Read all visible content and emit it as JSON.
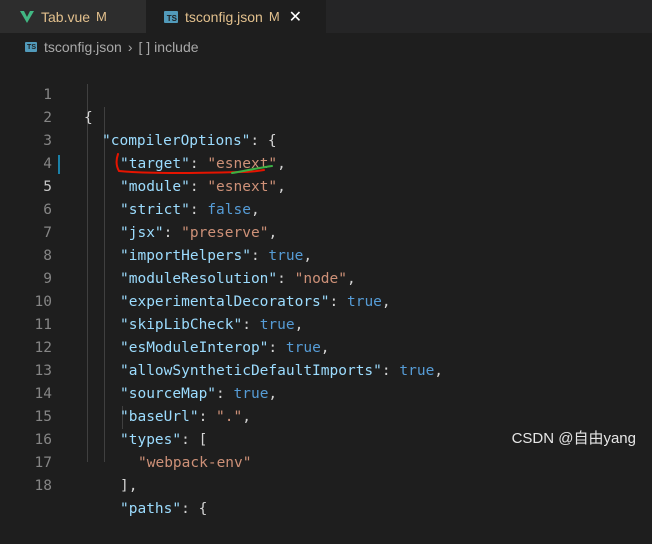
{
  "tabs": [
    {
      "label": "Tab.vue",
      "badge": "M",
      "icon": "vue-icon"
    },
    {
      "label": "tsconfig.json",
      "badge": "M",
      "icon": "ts-icon",
      "icon_text": "TS",
      "active": true
    }
  ],
  "tab_close_glyph": "✕",
  "breadcrumb": {
    "file": "tsconfig.json",
    "separator": "›",
    "symbol_icon": "[ ]",
    "symbol": "include"
  },
  "line_numbers": [
    "1",
    "2",
    "3",
    "4",
    "5",
    "6",
    "7",
    "8",
    "9",
    "10",
    "11",
    "12",
    "13",
    "14",
    "15",
    "16",
    "17",
    "18"
  ],
  "code": {
    "l1": "{",
    "l2k": "\"compilerOptions\"",
    "l2p": ": {",
    "l3k": "\"target\"",
    "l3c": ": ",
    "l3v": "\"esnext\"",
    "l3e": ",",
    "l4k": "\"module\"",
    "l4c": ": ",
    "l4v": "\"esnext\"",
    "l4e": ",",
    "l5k": "\"strict\"",
    "l5c": ": ",
    "l5v": "false",
    "l5e": ",",
    "l6k": "\"jsx\"",
    "l6c": ": ",
    "l6v": "\"preserve\"",
    "l6e": ",",
    "l7k": "\"importHelpers\"",
    "l7c": ": ",
    "l7v": "true",
    "l7e": ",",
    "l8k": "\"moduleResolution\"",
    "l8c": ": ",
    "l8v": "\"node\"",
    "l8e": ",",
    "l9k": "\"experimentalDecorators\"",
    "l9c": ": ",
    "l9v": "true",
    "l9e": ",",
    "l10k": "\"skipLibCheck\"",
    "l10c": ": ",
    "l10v": "true",
    "l10e": ",",
    "l11k": "\"esModuleInterop\"",
    "l11c": ": ",
    "l11v": "true",
    "l11e": ",",
    "l12k": "\"allowSyntheticDefaultImports\"",
    "l12c": ": ",
    "l12v": "true",
    "l12e": ",",
    "l13k": "\"sourceMap\"",
    "l13c": ": ",
    "l13v": "true",
    "l13e": ",",
    "l14k": "\"baseUrl\"",
    "l14c": ": ",
    "l14v": "\".\"",
    "l14e": ",",
    "l15k": "\"types\"",
    "l15p": ": [",
    "l16v": "\"webpack-env\"",
    "l17": "],",
    "l18k": "\"paths\"",
    "l18p": ": {"
  },
  "watermark": "CSDN @自由yang",
  "colors": {
    "key": "#9cdcfe",
    "string": "#ce9178",
    "keyword": "#569cd6",
    "annotation_red": "#e51400",
    "annotation_green": "#3cb043"
  }
}
